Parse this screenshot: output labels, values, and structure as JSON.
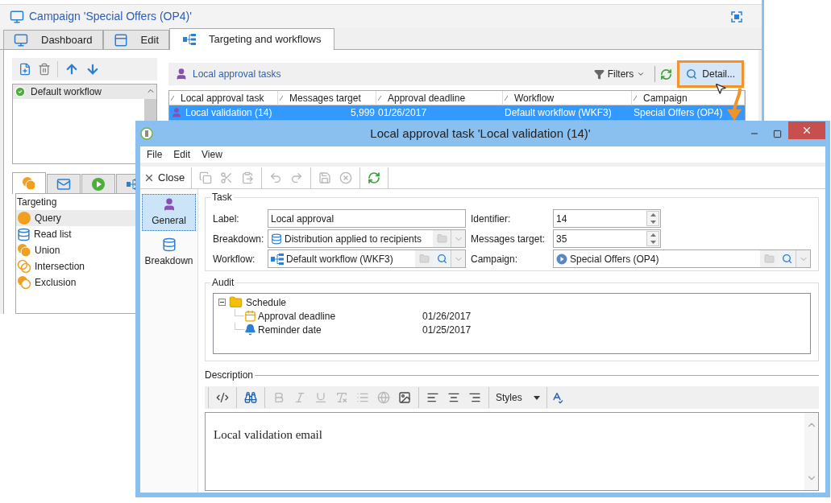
{
  "main_window": {
    "title": "Campaign 'Special Offers (OP4)'",
    "tabs": [
      {
        "label": "Dashboard",
        "kind": "dashboard",
        "selected": false
      },
      {
        "label": "Edit",
        "kind": "edit",
        "selected": false
      },
      {
        "label": "Targeting and workflows",
        "kind": "workflow",
        "selected": true
      }
    ],
    "workflows": [
      {
        "label": "Default workflow",
        "selected": true
      }
    ],
    "palette_tabs": [
      {
        "kind": "targeting",
        "selected": true
      },
      {
        "kind": "delivery",
        "selected": false
      },
      {
        "kind": "run",
        "selected": false
      },
      {
        "kind": "workflow",
        "selected": false
      }
    ],
    "palette": {
      "heading": "Targeting",
      "items": [
        {
          "label": "Query",
          "kind": "query",
          "selected": true
        },
        {
          "label": "Read list",
          "kind": "list",
          "selected": false
        },
        {
          "label": "Union",
          "kind": "union",
          "selected": false
        },
        {
          "label": "Intersection",
          "kind": "intersection",
          "selected": false
        },
        {
          "label": "Exclusion",
          "kind": "exclusion",
          "selected": false
        }
      ]
    },
    "list_title": "Local approval tasks",
    "filters": "Filters",
    "detail_button": "Detail...",
    "table": {
      "columns": [
        "Local approval task",
        "Messages target",
        "Approval deadline",
        "Workflow",
        "Campaign"
      ],
      "rows": [
        {
          "cells": [
            "Local validation (14)",
            "5,999",
            "01/26/2017",
            "Default workflow (WKF3)",
            "Special Offers (OP4)"
          ],
          "selected": true
        }
      ]
    }
  },
  "dialog": {
    "title": "Local approval task 'Local validation (14)'",
    "menu": [
      "File",
      "Edit",
      "View"
    ],
    "close": "Close",
    "toolbar": [
      [
        {
          "kind": "copy",
          "disabled": true
        },
        {
          "kind": "cut",
          "disabled": true
        },
        {
          "kind": "paste",
          "disabled": true
        }
      ],
      [
        {
          "kind": "undo",
          "disabled": true
        },
        {
          "kind": "redo",
          "disabled": true
        }
      ],
      [
        {
          "kind": "save",
          "disabled": true
        },
        {
          "kind": "cancel",
          "disabled": true
        }
      ],
      [
        {
          "kind": "refresh",
          "disabled": false
        }
      ]
    ],
    "nav": [
      {
        "label": "General",
        "kind": "general",
        "selected": true
      },
      {
        "label": "Breakdown",
        "kind": "breakdown",
        "selected": false
      }
    ],
    "task": {
      "heading": "Task",
      "label": {
        "label": "Label:",
        "value": "Local approval"
      },
      "breakdown": {
        "label": "Breakdown:",
        "value": "Distribution applied to recipients"
      },
      "workflow": {
        "label": "Workflow:",
        "value": "Default workflow (WKF3)"
      },
      "identifier": {
        "label": "Identifier:",
        "value": "14"
      },
      "messages_target": {
        "label": "Messages target:",
        "value": "35"
      },
      "campaign": {
        "label": "Campaign:",
        "value": "Special Offers (OP4)"
      }
    },
    "audit": {
      "heading": "Audit",
      "tree": [
        {
          "label": "Schedule",
          "expanded": true,
          "children": [
            {
              "label": "Approval deadline",
              "kind": "calendar",
              "value": "01/26/2017"
            },
            {
              "label": "Reminder date",
              "kind": "reminder",
              "value": "01/25/2017"
            }
          ]
        }
      ]
    },
    "description": {
      "heading": "Description",
      "toolbar": [
        [
          {
            "kind": "source",
            "disabled": false
          }
        ],
        [
          {
            "kind": "find",
            "disabled": false
          }
        ],
        [
          {
            "kind": "bold",
            "disabled": true
          },
          {
            "kind": "italic",
            "disabled": true
          },
          {
            "kind": "underline",
            "disabled": true
          },
          {
            "kind": "format",
            "disabled": true
          },
          {
            "kind": "list",
            "disabled": true
          },
          {
            "kind": "link",
            "disabled": true
          },
          {
            "kind": "image",
            "disabled": false
          }
        ],
        [
          {
            "kind": "align-left",
            "disabled": false
          },
          {
            "kind": "align-center",
            "disabled": false
          },
          {
            "kind": "align-right",
            "disabled": false
          }
        ]
      ],
      "styles": "Styles",
      "text": "Local validation email"
    }
  }
}
